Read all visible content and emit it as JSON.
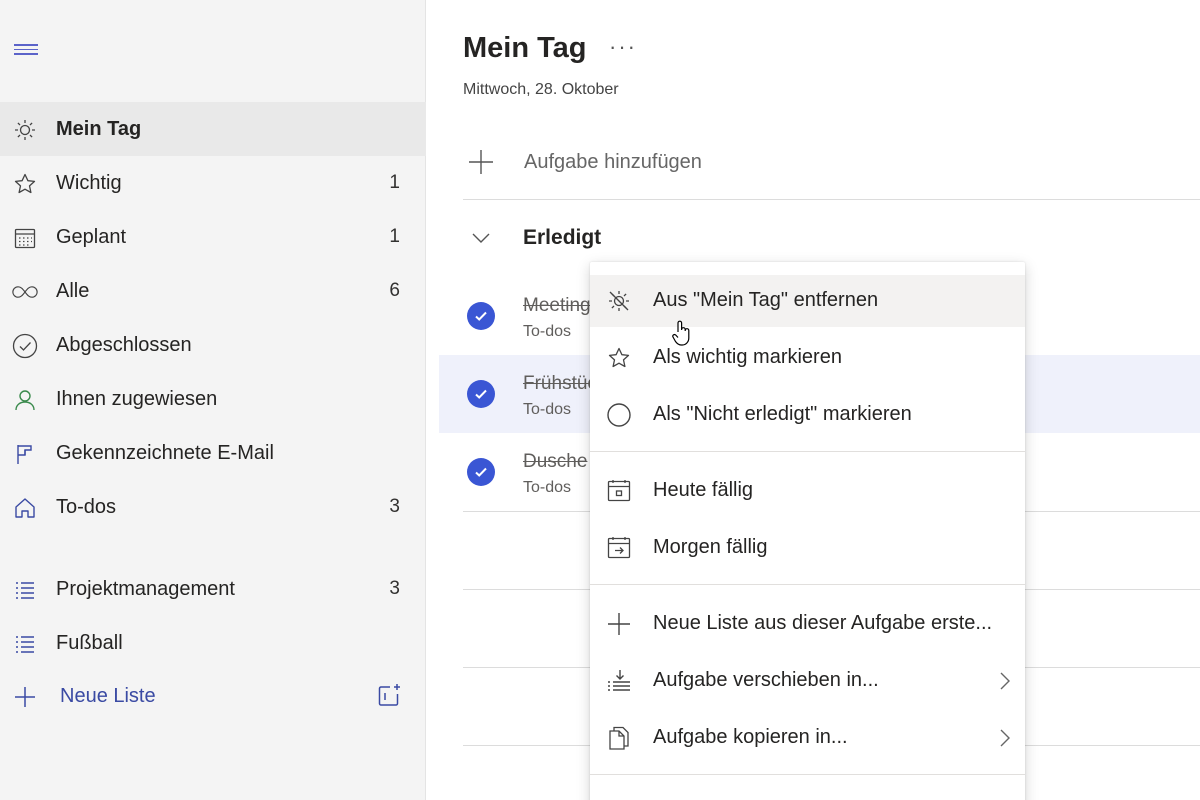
{
  "sidebar": {
    "menu_icon": "hamburger-icon",
    "items": [
      {
        "label": "Mein Tag",
        "count": "",
        "icon": "sun-icon"
      },
      {
        "label": "Wichtig",
        "count": "1",
        "icon": "star-icon"
      },
      {
        "label": "Geplant",
        "count": "1",
        "icon": "calendar-icon"
      },
      {
        "label": "Alle",
        "count": "6",
        "icon": "infinity-icon"
      },
      {
        "label": "Abgeschlossen",
        "count": "",
        "icon": "check-circle-icon"
      },
      {
        "label": "Ihnen zugewiesen",
        "count": "",
        "icon": "person-icon"
      },
      {
        "label": "Gekennzeichnete E-Mail",
        "count": "",
        "icon": "flag-icon"
      },
      {
        "label": "To-dos",
        "count": "3",
        "icon": "home-icon"
      },
      {
        "label": "Projektmanagement",
        "count": "3",
        "icon": "list-icon"
      },
      {
        "label": "Fußball",
        "count": "",
        "icon": "list-icon"
      }
    ],
    "new_list": {
      "label": "Neue Liste",
      "icon": "plus-icon",
      "group_icon": "new-group-icon"
    }
  },
  "main": {
    "title": "Mein Tag",
    "more": "···",
    "date": "Mittwoch, 28. Oktober",
    "add_task": "Aufgabe hinzufügen",
    "done_section": "Erledigt",
    "tasks": [
      {
        "title": "Meeting",
        "list": "To-dos",
        "completed": true
      },
      {
        "title": "Frühstück",
        "list": "To-dos",
        "completed": true
      },
      {
        "title": "Dusche",
        "list": "To-dos",
        "completed": true
      }
    ]
  },
  "context_menu": {
    "items": [
      {
        "label": "Aus \"Mein Tag\" entfernen",
        "icon": "sun-remove-icon"
      },
      {
        "label": "Als wichtig markieren",
        "icon": "star-icon"
      },
      {
        "label": "Als \"Nicht erledigt\" markieren",
        "icon": "circle-icon"
      },
      {
        "label": "Heute fällig",
        "icon": "calendar-today-icon"
      },
      {
        "label": "Morgen fällig",
        "icon": "calendar-tomorrow-icon"
      },
      {
        "label": "Neue Liste aus dieser Aufgabe erste...",
        "icon": "plus-icon"
      },
      {
        "label": "Aufgabe verschieben in...",
        "icon": "move-icon"
      },
      {
        "label": "Aufgabe kopieren in...",
        "icon": "copy-icon"
      }
    ]
  },
  "colors": {
    "accent": "#3a56d4",
    "nav_accent": "#3a4aa3",
    "sidebar_bg": "#f4f4f4",
    "selected_row": "#eff1fb"
  }
}
